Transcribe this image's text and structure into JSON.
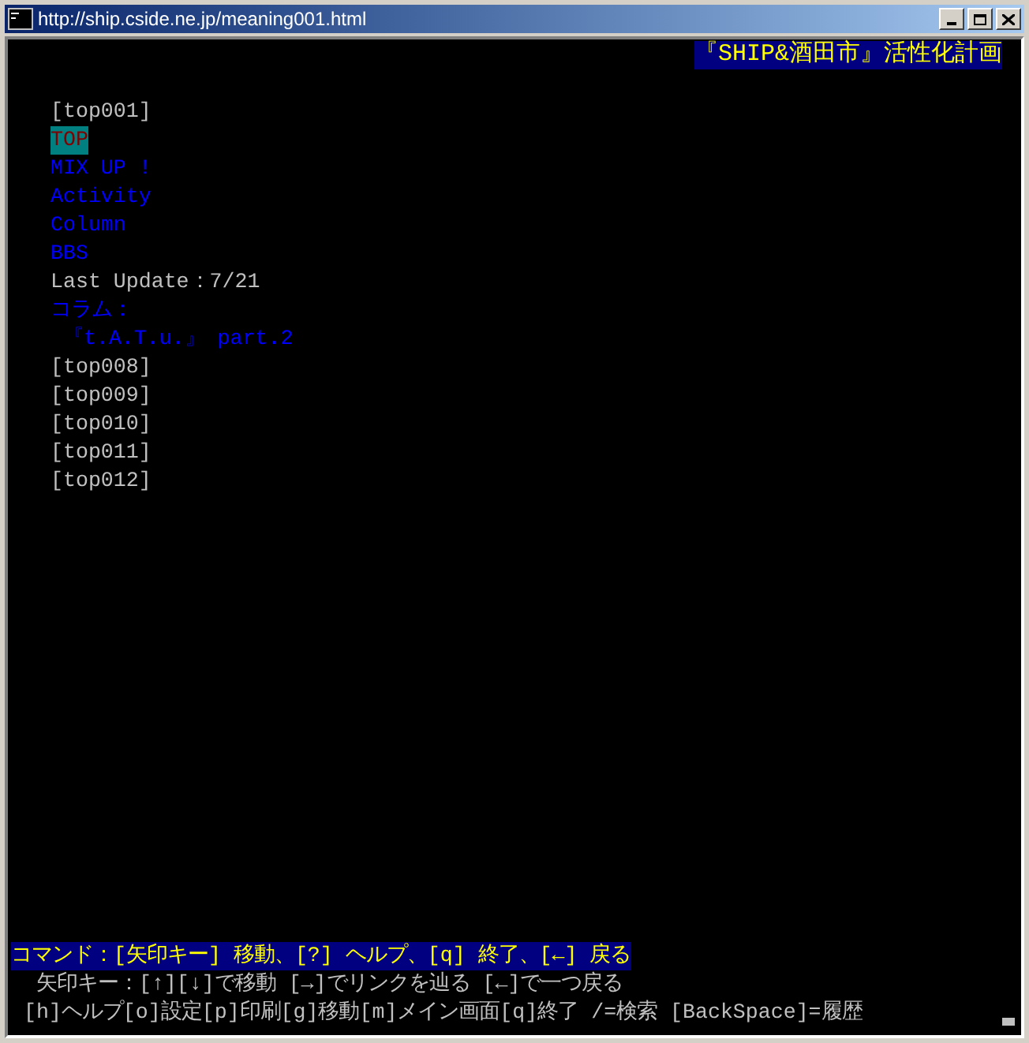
{
  "window": {
    "title": "http://ship.cside.ne.jp/meaning001.html"
  },
  "banner": "『SHIP&酒田市』活性化計画",
  "lines": [
    {
      "kind": "text",
      "text": "[top001]"
    },
    {
      "kind": "link",
      "text": "TOP",
      "selected": true
    },
    {
      "kind": "link",
      "text": "MIX UP !",
      "selected": false
    },
    {
      "kind": "link",
      "text": "Activity",
      "selected": false
    },
    {
      "kind": "link",
      "text": "Column",
      "selected": false
    },
    {
      "kind": "link",
      "text": "BBS",
      "selected": false
    },
    {
      "kind": "text",
      "text": "Last Update：7/21"
    },
    {
      "kind": "link",
      "text": "コラム：",
      "selected": false
    },
    {
      "kind": "link",
      "text": " 『t.A.T.u.』 part.2",
      "selected": false
    },
    {
      "kind": "text",
      "text": "[top008]"
    },
    {
      "kind": "text",
      "text": "[top009]"
    },
    {
      "kind": "text",
      "text": "[top010]"
    },
    {
      "kind": "text",
      "text": "[top011]"
    },
    {
      "kind": "text",
      "text": "[top012]"
    }
  ],
  "status": [
    {
      "kind": "command",
      "text": "コマンド：[矢印キー] 移動、[?] ヘルプ、[q] 終了、[←] 戻る"
    },
    {
      "kind": "help",
      "text": "  矢印キー：[↑][↓]で移動 [→]でリンクを辿る [←]で一つ戻る"
    },
    {
      "kind": "help",
      "text": " [h]ヘルプ[o]設定[p]印刷[g]移動[m]メイン画面[q]終了 /=検索 [BackSpace]=履歴"
    }
  ]
}
